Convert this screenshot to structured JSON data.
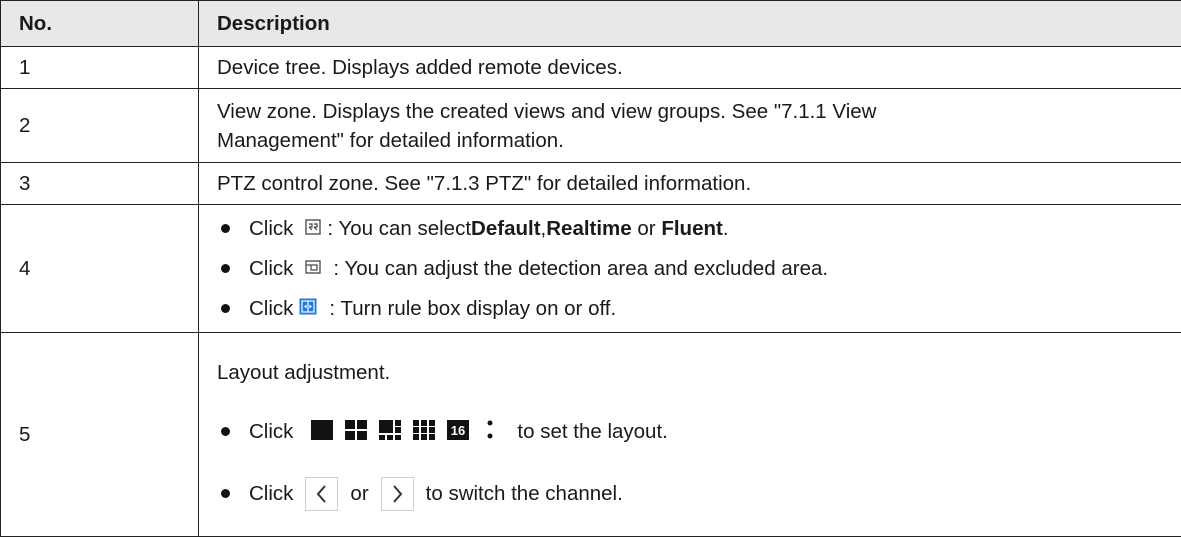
{
  "table": {
    "headers": [
      "No.",
      "Description"
    ],
    "rows": [
      {
        "no": "1",
        "text": "Device tree. Displays added remote devices."
      },
      {
        "no": "2",
        "line1": "View zone. Displays the created views and view groups. See \"7.1.1 View",
        "line2": "Management\" for detailed information."
      },
      {
        "no": "3",
        "text": "PTZ control zone. See \"7.1.3 PTZ\" for detailed information."
      },
      {
        "no": "4",
        "b1": {
          "click": "Click",
          "pre": ": You can select ",
          "opt1": "Default",
          "sep": ", ",
          "opt2": "Realtime",
          "or": " or ",
          "opt3": "Fluent",
          "end": "."
        },
        "b2": {
          "click": "Click",
          "text": ": You can adjust the detection area and excluded area."
        },
        "b3": {
          "click": "Click",
          "text": ": Turn rule box display on or off."
        }
      },
      {
        "no": "5",
        "intro": "Layout adjustment.",
        "b1": {
          "click": "Click",
          "text": "to set the layout.",
          "icon16_label": "16"
        },
        "b2": {
          "click": "Click",
          "or": "or",
          "text": "to switch the channel."
        }
      }
    ]
  },
  "icons": [
    "stream-type-icon",
    "detection-area-icon",
    "rule-box-icon",
    "layout-1-icon",
    "layout-4-icon",
    "layout-6-icon",
    "layout-9-icon",
    "layout-16-icon",
    "more-layouts-icon",
    "chevron-left-icon",
    "chevron-right-icon"
  ],
  "colors": {
    "header_bg": "#e8e8e8",
    "border": "#222222",
    "rule_box_icon": "#1e7bdc"
  }
}
